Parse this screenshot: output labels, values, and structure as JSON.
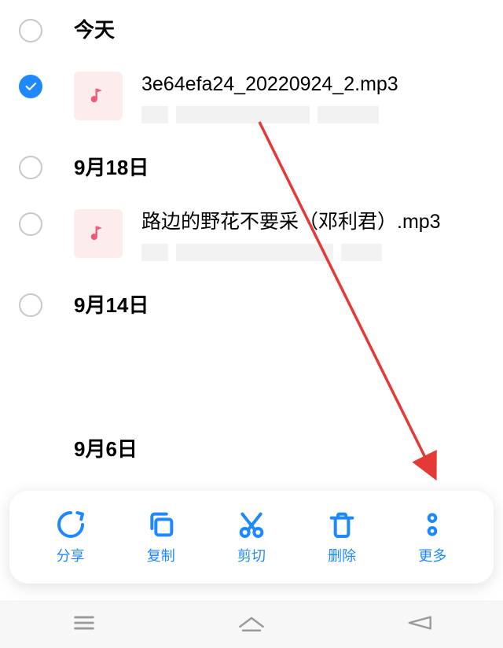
{
  "sections": {
    "today": "今天",
    "sep18": "9月18日",
    "sep14": "9月14日",
    "sep6": "9月6日"
  },
  "files": {
    "file1": {
      "name": "3e64efa24_20220924_2.mp3",
      "selected": true
    },
    "file2": {
      "name": "路边的野花不要采（邓利君）.mp3",
      "selected": false
    }
  },
  "actions": {
    "share": "分享",
    "copy": "复制",
    "cut": "剪切",
    "delete": "删除",
    "more": "更多"
  },
  "colors": {
    "accent": "#1e88ff",
    "music_thumb": "#fdecec",
    "music_note": "#f05a7a"
  }
}
